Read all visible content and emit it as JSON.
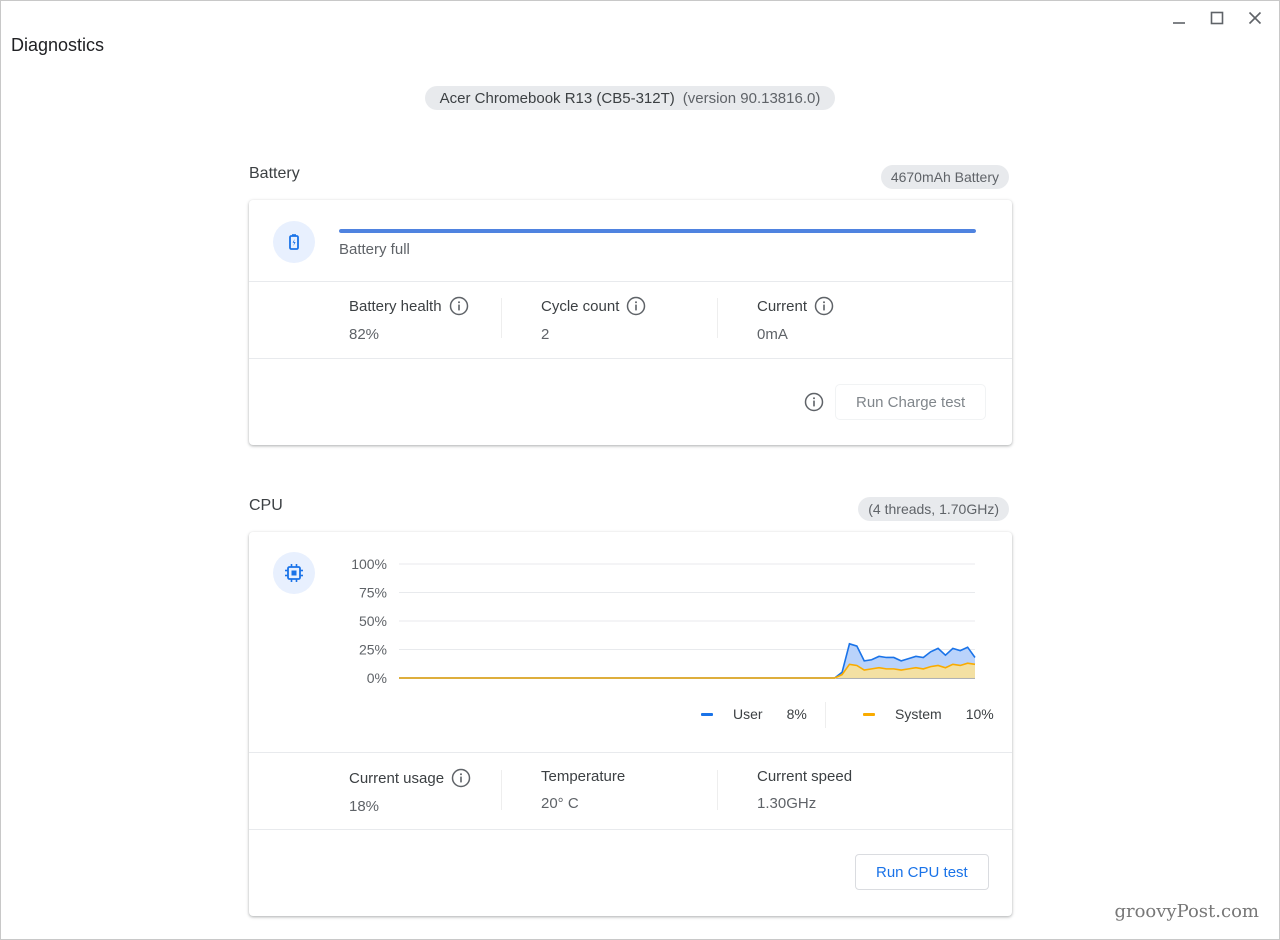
{
  "window": {
    "title": "Diagnostics"
  },
  "device": {
    "name": "Acer Chromebook R13 (CB5-312T)",
    "version": "(version 90.13816.0)"
  },
  "battery": {
    "section_title": "Battery",
    "capacity_badge": "4670mAh Battery",
    "icon": "battery-icon",
    "charge_fraction": 1.0,
    "status": "Battery full",
    "stats": {
      "health_label": "Battery health",
      "health_value": "82%",
      "cycle_label": "Cycle count",
      "cycle_value": "2",
      "current_label": "Current",
      "current_value": "0mA"
    },
    "run_button": "Run Charge test"
  },
  "cpu": {
    "section_title": "CPU",
    "spec_badge": "(4 threads, 1.70GHz)",
    "icon": "cpu-chip-icon",
    "legend": {
      "user_label": "User",
      "user_value": "8%",
      "system_label": "System",
      "system_value": "10%"
    },
    "stats": {
      "usage_label": "Current usage",
      "usage_value": "18%",
      "temp_label": "Temperature",
      "temp_value": "20° C",
      "speed_label": "Current speed",
      "speed_value": "1.30GHz"
    },
    "run_button": "Run CPU test"
  },
  "colors": {
    "user": "#1a73e8",
    "system": "#f9ab00",
    "user_fill": "#aecbfa",
    "system_fill": "#fde293",
    "accent": "#1a73e8"
  },
  "chart_data": {
    "type": "area",
    "y_ticks": [
      "100%",
      "75%",
      "50%",
      "25%",
      "0%"
    ],
    "ylim": [
      0,
      100
    ],
    "series": [
      {
        "name": "User",
        "values": [
          0,
          0,
          0,
          0,
          0,
          0,
          0,
          0,
          0,
          0,
          0,
          0,
          0,
          0,
          0,
          0,
          0,
          0,
          0,
          0,
          0,
          0,
          0,
          0,
          0,
          0,
          0,
          0,
          0,
          0,
          0,
          0,
          0,
          0,
          0,
          0,
          0,
          0,
          0,
          0,
          0,
          0,
          0,
          0,
          0,
          0,
          0,
          0,
          0,
          0,
          0,
          0,
          0,
          0,
          0,
          0,
          0,
          0,
          0,
          0,
          5,
          30,
          28,
          15,
          16,
          19,
          18,
          18,
          15,
          17,
          19,
          18,
          23,
          26,
          20,
          26,
          24,
          27,
          18
        ]
      },
      {
        "name": "System",
        "values": [
          0,
          0,
          0,
          0,
          0,
          0,
          0,
          0,
          0,
          0,
          0,
          0,
          0,
          0,
          0,
          0,
          0,
          0,
          0,
          0,
          0,
          0,
          0,
          0,
          0,
          0,
          0,
          0,
          0,
          0,
          0,
          0,
          0,
          0,
          0,
          0,
          0,
          0,
          0,
          0,
          0,
          0,
          0,
          0,
          0,
          0,
          0,
          0,
          0,
          0,
          0,
          0,
          0,
          0,
          0,
          0,
          0,
          0,
          0,
          0,
          3,
          12,
          11,
          7,
          8,
          9,
          8,
          8,
          7,
          8,
          9,
          8,
          10,
          11,
          9,
          12,
          11,
          13,
          12
        ]
      }
    ]
  },
  "watermark": "groovyPost.com"
}
